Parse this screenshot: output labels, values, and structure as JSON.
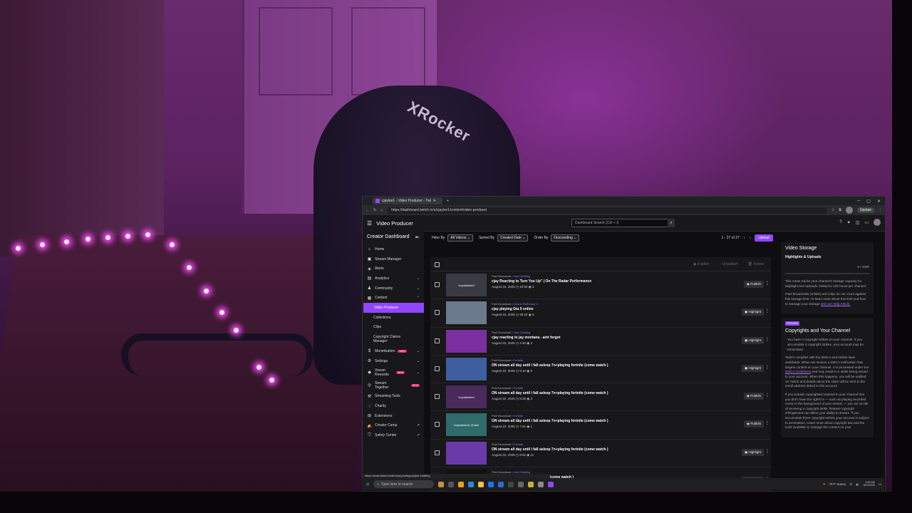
{
  "browser": {
    "tab_title": "cjaylxe1 - Video Producer - Twi",
    "url": "https://dashboard.twitch.tv/u/cjaylxe1/content/video-producer",
    "update_label": "Update"
  },
  "topnav": {
    "title": "Video Producer",
    "search_placeholder": "Dashboard Search (Ctrl + /)"
  },
  "sidebar": {
    "heading": "Creator Dashboard",
    "items": [
      {
        "label": "Home",
        "icon": "home-icon"
      },
      {
        "label": "Stream Manager",
        "icon": "stream-icon"
      },
      {
        "label": "Alerts",
        "icon": "alert-icon"
      },
      {
        "label": "Analytics",
        "icon": "chart-icon"
      },
      {
        "label": "Community",
        "icon": "people-icon"
      },
      {
        "label": "Content",
        "icon": "content-icon"
      },
      {
        "label": "Video Producer"
      },
      {
        "label": "Collections"
      },
      {
        "label": "Clips"
      },
      {
        "label": "Copyright Claims Manager"
      },
      {
        "label": "Monetization",
        "icon": "money-icon",
        "badge": "NEW"
      },
      {
        "label": "Settings",
        "icon": "gear-icon"
      },
      {
        "label": "Viewer Rewards",
        "icon": "gift-icon",
        "badge": "NEW"
      },
      {
        "label": "Stream Together",
        "icon": "together-icon",
        "badge": "NEW"
      },
      {
        "label": "Streaming Tools",
        "icon": "tools-icon"
      },
      {
        "label": "Charity",
        "icon": "heart-icon"
      },
      {
        "label": "Extensions",
        "icon": "puzzle-icon"
      },
      {
        "label": "Creator Camp",
        "icon": "camp-icon"
      },
      {
        "label": "Safety Center",
        "icon": "shield-icon"
      }
    ]
  },
  "filters": {
    "filter_by_label": "Filter By",
    "filter_by_value": "All Videos",
    "sorted_by_label": "Sorted By",
    "sorted_by_value": "Created Date",
    "order_by_label": "Order By",
    "order_by_value": "Descending",
    "range": "1 - 27 of 27",
    "upload_label": "Upload"
  },
  "bulk": {
    "publish": "Publish",
    "unpublish": "Unpublish",
    "delete": "Delete"
  },
  "videos": [
    {
      "type": "Past Broadcast",
      "category": "Just Chatting",
      "title": "cjay Reacting to Turn You Up\" | On The Radar Performance",
      "date": "August 22, 2025",
      "duration": "10:00",
      "views": "3",
      "overlay": "Unpublished",
      "action": "Publish",
      "thumb": "#3a3a44"
    },
    {
      "type": "Past Broadcast",
      "category": "Grand Theft Auto V",
      "title": "cjay playing Gta 5 online",
      "date": "August 22, 2025",
      "duration": "30:22",
      "views": "6",
      "overlay": "",
      "action": "Highlight",
      "thumb": "#6b7a8c"
    },
    {
      "type": "Past Broadcast",
      "category": "Just Chatting",
      "title": "cjay reacting to jay montana - aint forgot",
      "date": "August 22, 2025",
      "duration": "4:30",
      "views": "3",
      "overlay": "",
      "action": "Highlight",
      "thumb": "#7a2fa0"
    },
    {
      "type": "Past Broadcast",
      "category": "Fortnite",
      "title": "ON stream all day until i fall asleep 7n+playing fortnite (come watch )",
      "date": "August 22, 2025",
      "duration": "9:10",
      "views": "5",
      "overlay": "",
      "action": "Highlight",
      "thumb": "#3f5ea0"
    },
    {
      "type": "Past Broadcast",
      "category": "Fortnite",
      "title": "ON stream all day until i fall asleep 7n+playing fortnite (come watch )",
      "date": "August 22, 2025",
      "duration": "8:29",
      "views": "3",
      "overlay": "Unpublished",
      "action": "Publish",
      "thumb": "#4a2a5c"
    },
    {
      "type": "Past Broadcast",
      "category": "Fortnite",
      "title": "ON stream all day until i fall asleep 7n+playing fortnite (come watch )",
      "date": "August 22, 2025",
      "duration": "7:41",
      "views": "1",
      "overlay": "Unpublished, Muted",
      "action": "Publish",
      "thumb": "#2f6b6b"
    },
    {
      "type": "Past Broadcast",
      "category": "Fortnite",
      "title": "ON stream all day until i fall asleep 7n+playing fortnite (come watch )",
      "date": "August 22, 2025",
      "duration": "8:52",
      "views": "11",
      "overlay": "",
      "action": "Highlight",
      "thumb": "#6a3aa8"
    },
    {
      "type": "Past Broadcast",
      "category": "Just Chatting",
      "title": "ON stream all night until i wake up(come watch )",
      "date": "",
      "duration": "",
      "views": "",
      "overlay": "",
      "action": "Highlight",
      "thumb": "#111"
    }
  ],
  "storage": {
    "title": "Video Storage",
    "subtitle": "Highlights & Uploads",
    "usage": "0 / 100h",
    "p1": "This meter tracks your channel's storage capacity for Highlight and Uploads, limited to 100 hours per channel.",
    "p2": "Past Broadcasts (VODs) and Clips do not count against this storage limit. To learn more about this limit and how to manage your storage",
    "p2_link": "visit our Help Article."
  },
  "copyright": {
    "pill": "PREVIEW",
    "title": "Copyrights and Your Channel",
    "p1": "You have 0 copyright strikes on your channel. If you accumulate 3 copyright strikes, your account may be terminated.",
    "p2": "Twitch complies with the DMCA and similar laws worldwide. When we receive a DMCA notification that targets content on your channel, it is processed under our",
    "p2_link": "DMCA Guidelines",
    "p2b": "and may result in a strike being issued to your account. When this happens, you will be notified on Twitch and details about the claim will be sent to the email address linked to this account.",
    "p3": "If you include copyrighted material in your channel that you don't have the rights to — such as playing recorded music in the background of your stream — you are at risk of receiving a copyright strike. Repeat copyright infringement can affect your ability to stream. If you accumulate three copyright strikes your account is subject to termination. Learn more about copyright law and the tools available to manage the content on your"
  },
  "status_url": "https://www.twitch.tv/directory/category/just-chatting",
  "taskbar": {
    "search_placeholder": "Type here to search",
    "weather": "76°F Sunny",
    "time": "3:46 AM",
    "date": "8/22/2025"
  },
  "webcam": {
    "chair_brand": "XRocker"
  },
  "colors": {
    "accent": "#9146ff",
    "badge": "#e91e63"
  }
}
